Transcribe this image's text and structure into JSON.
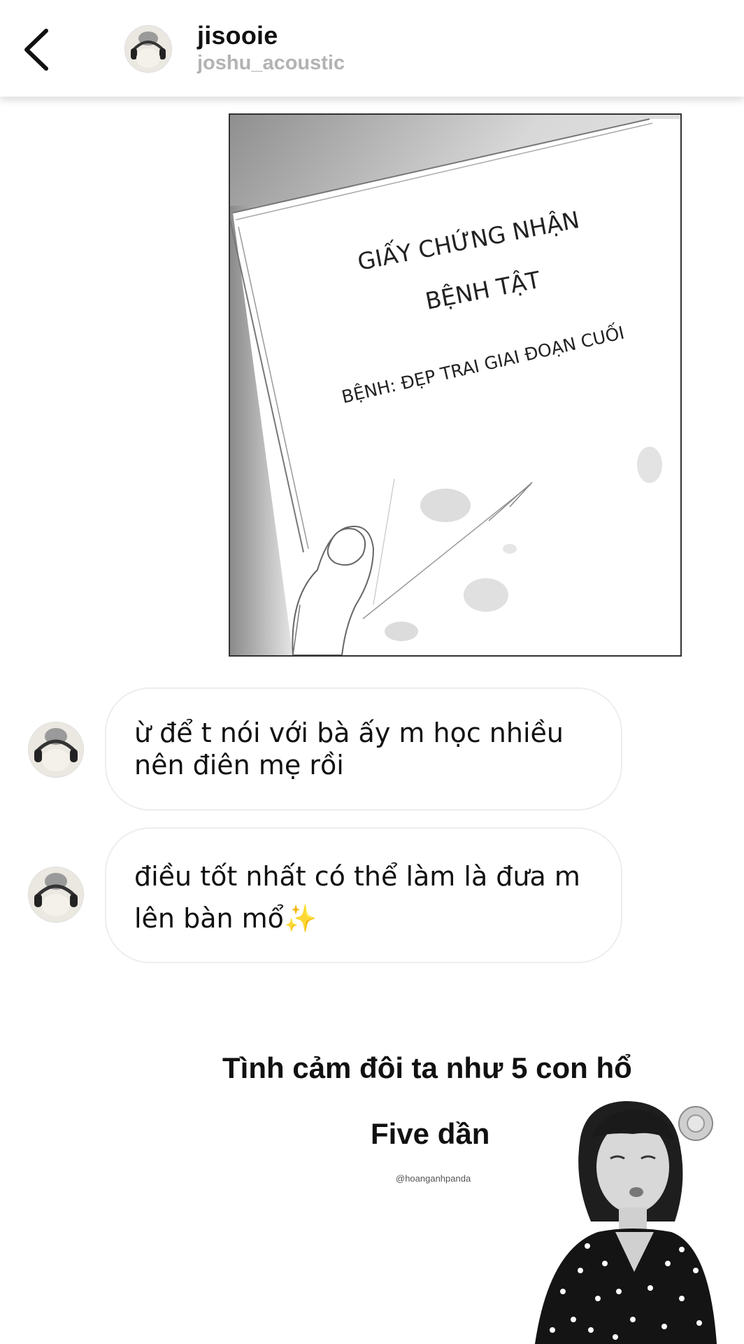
{
  "header": {
    "name": "jisooie",
    "username": "joshu_acoustic",
    "back_icon": "chevron-left-icon"
  },
  "image_message": {
    "doc_title_line1": "GIẤY CHỨNG NHẬN",
    "doc_title_line2": "BỆNH TẬT",
    "doc_body": "BỆNH: ĐẸP TRAI GIAI ĐOẠN CUỐI"
  },
  "messages": [
    {
      "lines": [
        "ừ để t nói với bà ấy m học nhiều",
        "nên điên mẹ rồi"
      ]
    },
    {
      "line1": "điều tốt nhất có thể làm là đưa m",
      "line2": "lên bàn mổ",
      "emoji": "✨"
    }
  ],
  "meme": {
    "line1": "Tình cảm đôi ta như 5 con hổ",
    "line2": "Five dần",
    "credit": "@hoanganhpanda"
  },
  "colors": {
    "username": "#b3b3b3",
    "bubble_border": "#ededed",
    "text": "#111111"
  }
}
